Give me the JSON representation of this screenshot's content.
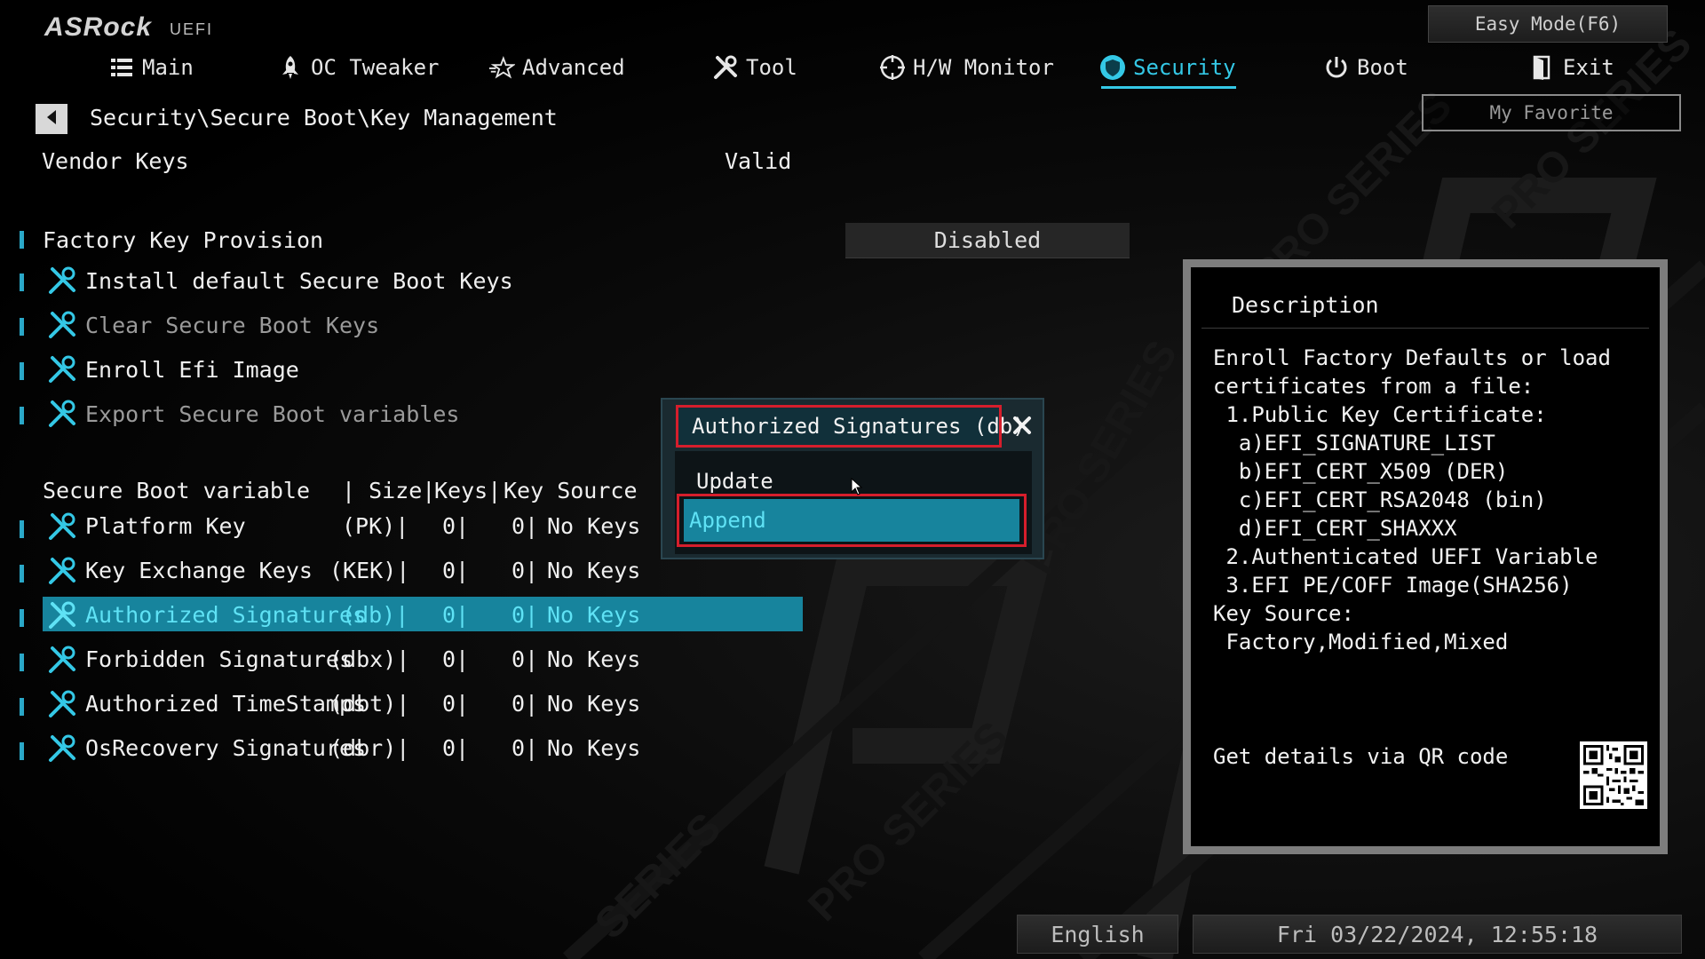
{
  "header": {
    "brand": "ASRock",
    "brand_sub": "UEFI",
    "easy_mode_label": "Easy Mode(F6)",
    "my_favorite_label": "My Favorite"
  },
  "tabs": [
    {
      "label": "Main",
      "icon": "list-icon"
    },
    {
      "label": "OC Tweaker",
      "icon": "rocket-icon"
    },
    {
      "label": "Advanced",
      "icon": "star-icon"
    },
    {
      "label": "Tool",
      "icon": "wrench-icon"
    },
    {
      "label": "H/W Monitor",
      "icon": "crosshair-icon"
    },
    {
      "label": "Security",
      "icon": "shield-icon",
      "active": true
    },
    {
      "label": "Boot",
      "icon": "power-icon"
    },
    {
      "label": "Exit",
      "icon": "door-icon"
    }
  ],
  "breadcrumb": "Security\\Secure Boot\\Key Management",
  "vendor_keys": {
    "label": "Vendor Keys",
    "value": "Valid"
  },
  "factory_key_provision": {
    "label": "Factory Key Provision",
    "value": "Disabled"
  },
  "actions": [
    {
      "label": "Install default Secure Boot Keys",
      "enabled": true
    },
    {
      "label": "Clear Secure Boot Keys",
      "enabled": false
    },
    {
      "label": "Enroll Efi Image",
      "enabled": true
    },
    {
      "label": "Export Secure Boot variables",
      "enabled": false
    }
  ],
  "table": {
    "header": {
      "variable": "Secure Boot variable",
      "size": "| Size|",
      "keys": "Keys|",
      "source": "Key Source"
    },
    "rows": [
      {
        "name": "Platform Key",
        "abbr": "(PK)|",
        "size": "0|",
        "keys": "0|",
        "source": "No Keys"
      },
      {
        "name": "Key Exchange Keys",
        "abbr": "(KEK)|",
        "size": "0|",
        "keys": "0|",
        "source": "No Keys"
      },
      {
        "name": "Authorized Signatures",
        "abbr": "(db)|",
        "size": "0|",
        "keys": "0|",
        "source": "No Keys",
        "selected": true
      },
      {
        "name": "Forbidden  Signatures",
        "abbr": "(dbx)|",
        "size": "0|",
        "keys": "0|",
        "source": "No Keys"
      },
      {
        "name": "Authorized TimeStamps",
        "abbr": "(dbt)|",
        "size": "0|",
        "keys": "0|",
        "source": "No Keys"
      },
      {
        "name": "OsRecovery Signatures",
        "abbr": "(dbr)|",
        "size": "0|",
        "keys": "0|",
        "source": "No Keys"
      }
    ]
  },
  "popup": {
    "title": "Authorized Signatures (db)",
    "options": [
      "Update",
      "Append"
    ],
    "selected": "Append"
  },
  "description": {
    "title": "Description",
    "lines": [
      "Enroll Factory Defaults or load",
      "certificates from a file:",
      " 1.Public Key Certificate:",
      "  a)EFI_SIGNATURE_LIST",
      "  b)EFI_CERT_X509 (DER)",
      "  c)EFI_CERT_RSA2048 (bin)",
      "  d)EFI_CERT_SHAXXX",
      " 2.Authenticated UEFI Variable",
      " 3.EFI PE/COFF Image(SHA256)",
      "Key Source:",
      " Factory,Modified,Mixed"
    ],
    "qr_label": "Get details via QR code"
  },
  "footer": {
    "language": "English",
    "datetime": "Fri 03/22/2024, 12:55:18"
  },
  "colors": {
    "accent": "#34c8e6",
    "selection": "#17849d",
    "highlight_frame": "#d61e2c"
  }
}
